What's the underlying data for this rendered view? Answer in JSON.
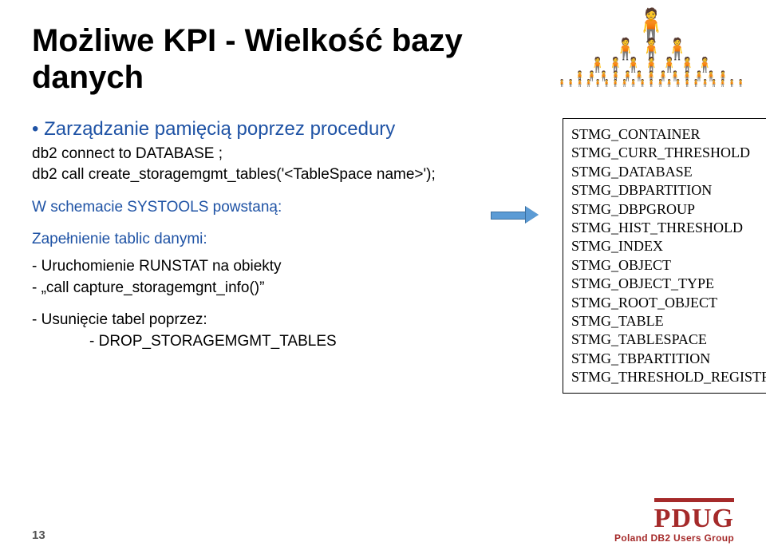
{
  "title_line1": "Możliwe KPI - Wielkość bazy",
  "title_line2": "danych",
  "bullet_heading": "• Zarządzanie pamięcią poprzez procedury",
  "code1": "db2 connect to DATABASE ;",
  "code2": "db2 call create_storagemgmt_tables('<TableSpace name>');",
  "schema_line": "W schemacie SYSTOOLS powstaną:",
  "fill_heading": "Zapełnienie tablic danymi:",
  "fill_item1": "- Uruchomienie RUNSTAT na obiekty",
  "fill_item2": "-  „call capture_storagemgnt_info()”",
  "delete_heading": "-   Usunięcie tabel poprzez:",
  "delete_item": "-   DROP_STORAGEMGMT_TABLES",
  "box_lines": [
    "STMG_CONTAINER",
    "STMG_CURR_THRESHOLD",
    "STMG_DATABASE",
    "STMG_DBPARTITION",
    "STMG_DBPGROUP",
    "STMG_HIST_THRESHOLD",
    "STMG_INDEX",
    "STMG_OBJECT",
    "STMG_OBJECT_TYPE",
    "STMG_ROOT_OBJECT",
    "STMG_TABLE",
    "STMG_TABLESPACE",
    "STMG_TBPARTITION",
    "STMG_THRESHOLD_REGISTRY"
  ],
  "page_number": "13",
  "logo_text": "PDUG",
  "logo_tag": "Poland DB2 Users Group"
}
